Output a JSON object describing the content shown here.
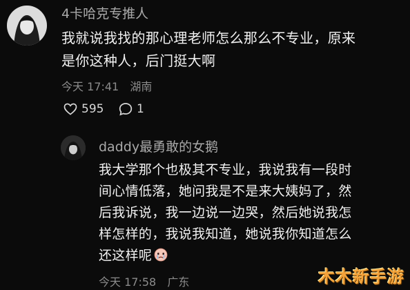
{
  "comment": {
    "author": "4卡哈克专推人",
    "lines": [
      "我就说我找的那心理老师怎么那么不专业，原来",
      "是你这种人，后门挺大啊"
    ],
    "timestamp": "今天 17:41",
    "location": "湖南",
    "likes": "595",
    "replies": "1"
  },
  "reply": {
    "author": "daddy最勇敢的女鹅",
    "lines": [
      "我大学那个也极其不专业，我说我有一段时",
      "间心情低落，她问我是不是来大姨妈了，然",
      "后我诉说，我一边说一边哭，然后她说我怎",
      "样怎样的，我说我知道，她说我你知道怎么",
      "还这样呢"
    ],
    "emoji_icon": "crying-face-icon",
    "timestamp": "今天 17:58",
    "location": "广东"
  },
  "watermark": "木木新手游"
}
